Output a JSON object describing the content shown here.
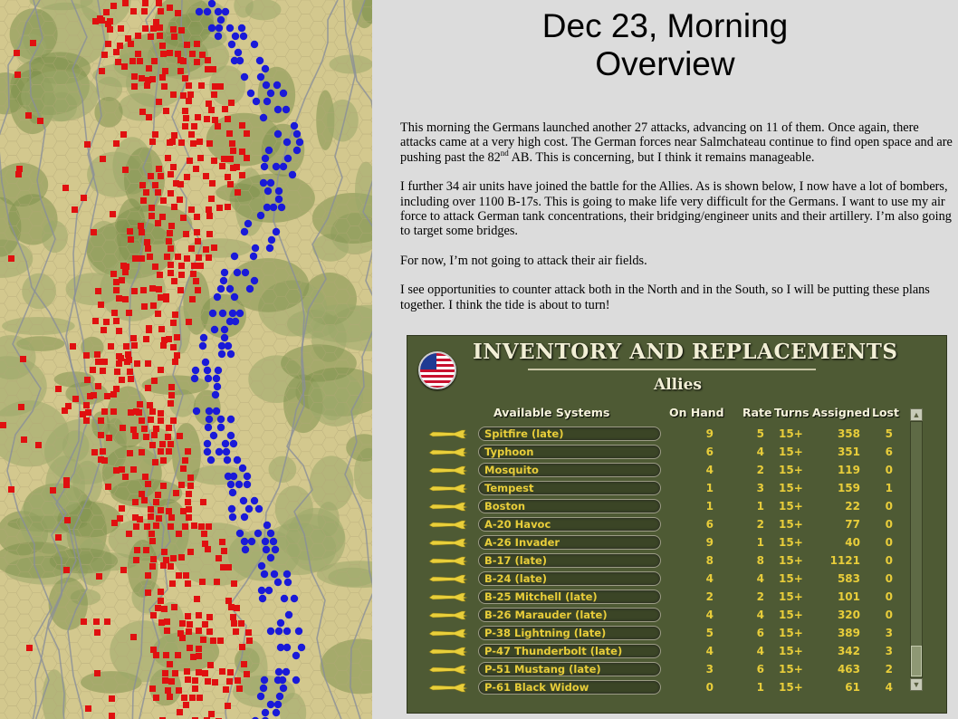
{
  "slide": {
    "title_line1": "Dec 23, Morning",
    "title_line2": "Overview",
    "paragraphs": [
      {
        "pre": "This morning the Germans launched another 27 attacks, advancing on 11 of them.  Once again, there attacks came at a very high cost.  The German forces near Salmchateau continue to find open space and are pushing past the 82",
        "sup": "nd",
        "post": " AB.  This is concerning, but I think it remains manageable."
      },
      {
        "pre": "I further 34 air units have joined the battle for the Allies.  As is shown below, I now have a lot of bombers, including over 1100 B-17s.  This is going to make life very difficult for the Germans.  I want to use my air force to attack German tank concentrations, their bridging/engineer units and their artillery.  I’m also going to target some bridges.",
        "sup": "",
        "post": ""
      },
      {
        "pre": "For now, I’m not going to attack their air fields.",
        "sup": "",
        "post": ""
      },
      {
        "pre": "I see opportunities to counter attack both in the North and in the South, so I will be putting these plans together.  I think the tide is about to turn!",
        "sup": "",
        "post": ""
      }
    ]
  },
  "panel": {
    "title": "INVENTORY AND REPLACEMENTS",
    "side": "Allies",
    "flag_icon": "us-flag-icon",
    "headers": {
      "systems": "Available Systems",
      "on_hand": "On Hand",
      "rate": "Rate",
      "turns": "Turns",
      "assigned": "Assigned",
      "lost": "Lost"
    },
    "rows": [
      {
        "name": "Spitfire (late)",
        "on_hand": "9",
        "rate": "5",
        "turns": "15+",
        "assigned": "358",
        "lost": "5"
      },
      {
        "name": "Typhoon",
        "on_hand": "6",
        "rate": "4",
        "turns": "15+",
        "assigned": "351",
        "lost": "6"
      },
      {
        "name": "Mosquito",
        "on_hand": "4",
        "rate": "2",
        "turns": "15+",
        "assigned": "119",
        "lost": "0"
      },
      {
        "name": "Tempest",
        "on_hand": "1",
        "rate": "3",
        "turns": "15+",
        "assigned": "159",
        "lost": "1"
      },
      {
        "name": "Boston",
        "on_hand": "1",
        "rate": "1",
        "turns": "15+",
        "assigned": "22",
        "lost": "0"
      },
      {
        "name": "A-20 Havoc",
        "on_hand": "6",
        "rate": "2",
        "turns": "15+",
        "assigned": "77",
        "lost": "0"
      },
      {
        "name": "A-26 Invader",
        "on_hand": "9",
        "rate": "1",
        "turns": "15+",
        "assigned": "40",
        "lost": "0"
      },
      {
        "name": "B-17 (late)",
        "on_hand": "8",
        "rate": "8",
        "turns": "15+",
        "assigned": "1121",
        "lost": "0"
      },
      {
        "name": "B-24 (late)",
        "on_hand": "4",
        "rate": "4",
        "turns": "15+",
        "assigned": "583",
        "lost": "0"
      },
      {
        "name": "B-25 Mitchell (late)",
        "on_hand": "2",
        "rate": "2",
        "turns": "15+",
        "assigned": "101",
        "lost": "0"
      },
      {
        "name": "B-26 Marauder (late)",
        "on_hand": "4",
        "rate": "4",
        "turns": "15+",
        "assigned": "320",
        "lost": "0"
      },
      {
        "name": "P-38 Lightning (late)",
        "on_hand": "5",
        "rate": "6",
        "turns": "15+",
        "assigned": "389",
        "lost": "3"
      },
      {
        "name": "P-47 Thunderbolt (late)",
        "on_hand": "4",
        "rate": "4",
        "turns": "15+",
        "assigned": "342",
        "lost": "3"
      },
      {
        "name": "P-51 Mustang (late)",
        "on_hand": "3",
        "rate": "6",
        "turns": "15+",
        "assigned": "463",
        "lost": "2"
      },
      {
        "name": "P-61 Black Widow",
        "on_hand": "0",
        "rate": "1",
        "turns": "15+",
        "assigned": "61",
        "lost": "4"
      }
    ]
  },
  "map": {
    "terrain_colors": {
      "clear": "#d3c88e",
      "forest": "#9aa86a",
      "dark_forest": "#7f924f",
      "road": "#8a8f9a"
    },
    "unit_colors": {
      "german": "#e01010",
      "allied": "#1a1ad8"
    },
    "icons": [
      "hex-map",
      "german-unit-marker",
      "allied-unit-marker"
    ]
  }
}
